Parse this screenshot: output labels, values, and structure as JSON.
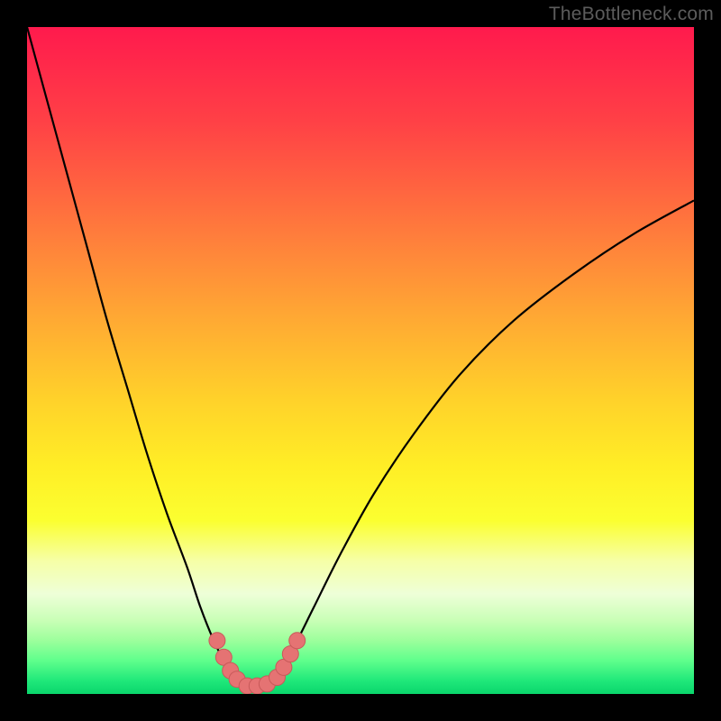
{
  "watermark": {
    "text": "TheBottleneck.com"
  },
  "colors": {
    "frame": "#000000",
    "curve_stroke": "#000000",
    "marker_fill": "#e57373",
    "marker_stroke": "#c85a5a"
  },
  "chart_data": {
    "type": "line",
    "title": "",
    "xlabel": "",
    "ylabel": "",
    "xlim": [
      0,
      100
    ],
    "ylim": [
      0,
      100
    ],
    "grid": false,
    "legend": false,
    "x": [
      0,
      3,
      6,
      9,
      12,
      15,
      18,
      21,
      24,
      26,
      28,
      30,
      31,
      32,
      33,
      34,
      35,
      36,
      37,
      38,
      40,
      43,
      47,
      52,
      58,
      65,
      73,
      82,
      91,
      100
    ],
    "values": [
      100,
      89,
      78,
      67,
      56,
      46,
      36,
      27,
      19,
      13,
      8,
      4,
      2.5,
      1.5,
      1,
      1,
      1,
      1.2,
      2,
      3.5,
      7,
      13,
      21,
      30,
      39,
      48,
      56,
      63,
      69,
      74
    ],
    "markers_x": [
      28.5,
      29.5,
      30.5,
      31.5,
      33.0,
      34.5,
      36.0,
      37.5,
      38.5,
      39.5,
      40.5
    ],
    "markers_y": [
      8.0,
      5.5,
      3.5,
      2.2,
      1.2,
      1.2,
      1.5,
      2.5,
      4.0,
      6.0,
      8.0
    ]
  }
}
